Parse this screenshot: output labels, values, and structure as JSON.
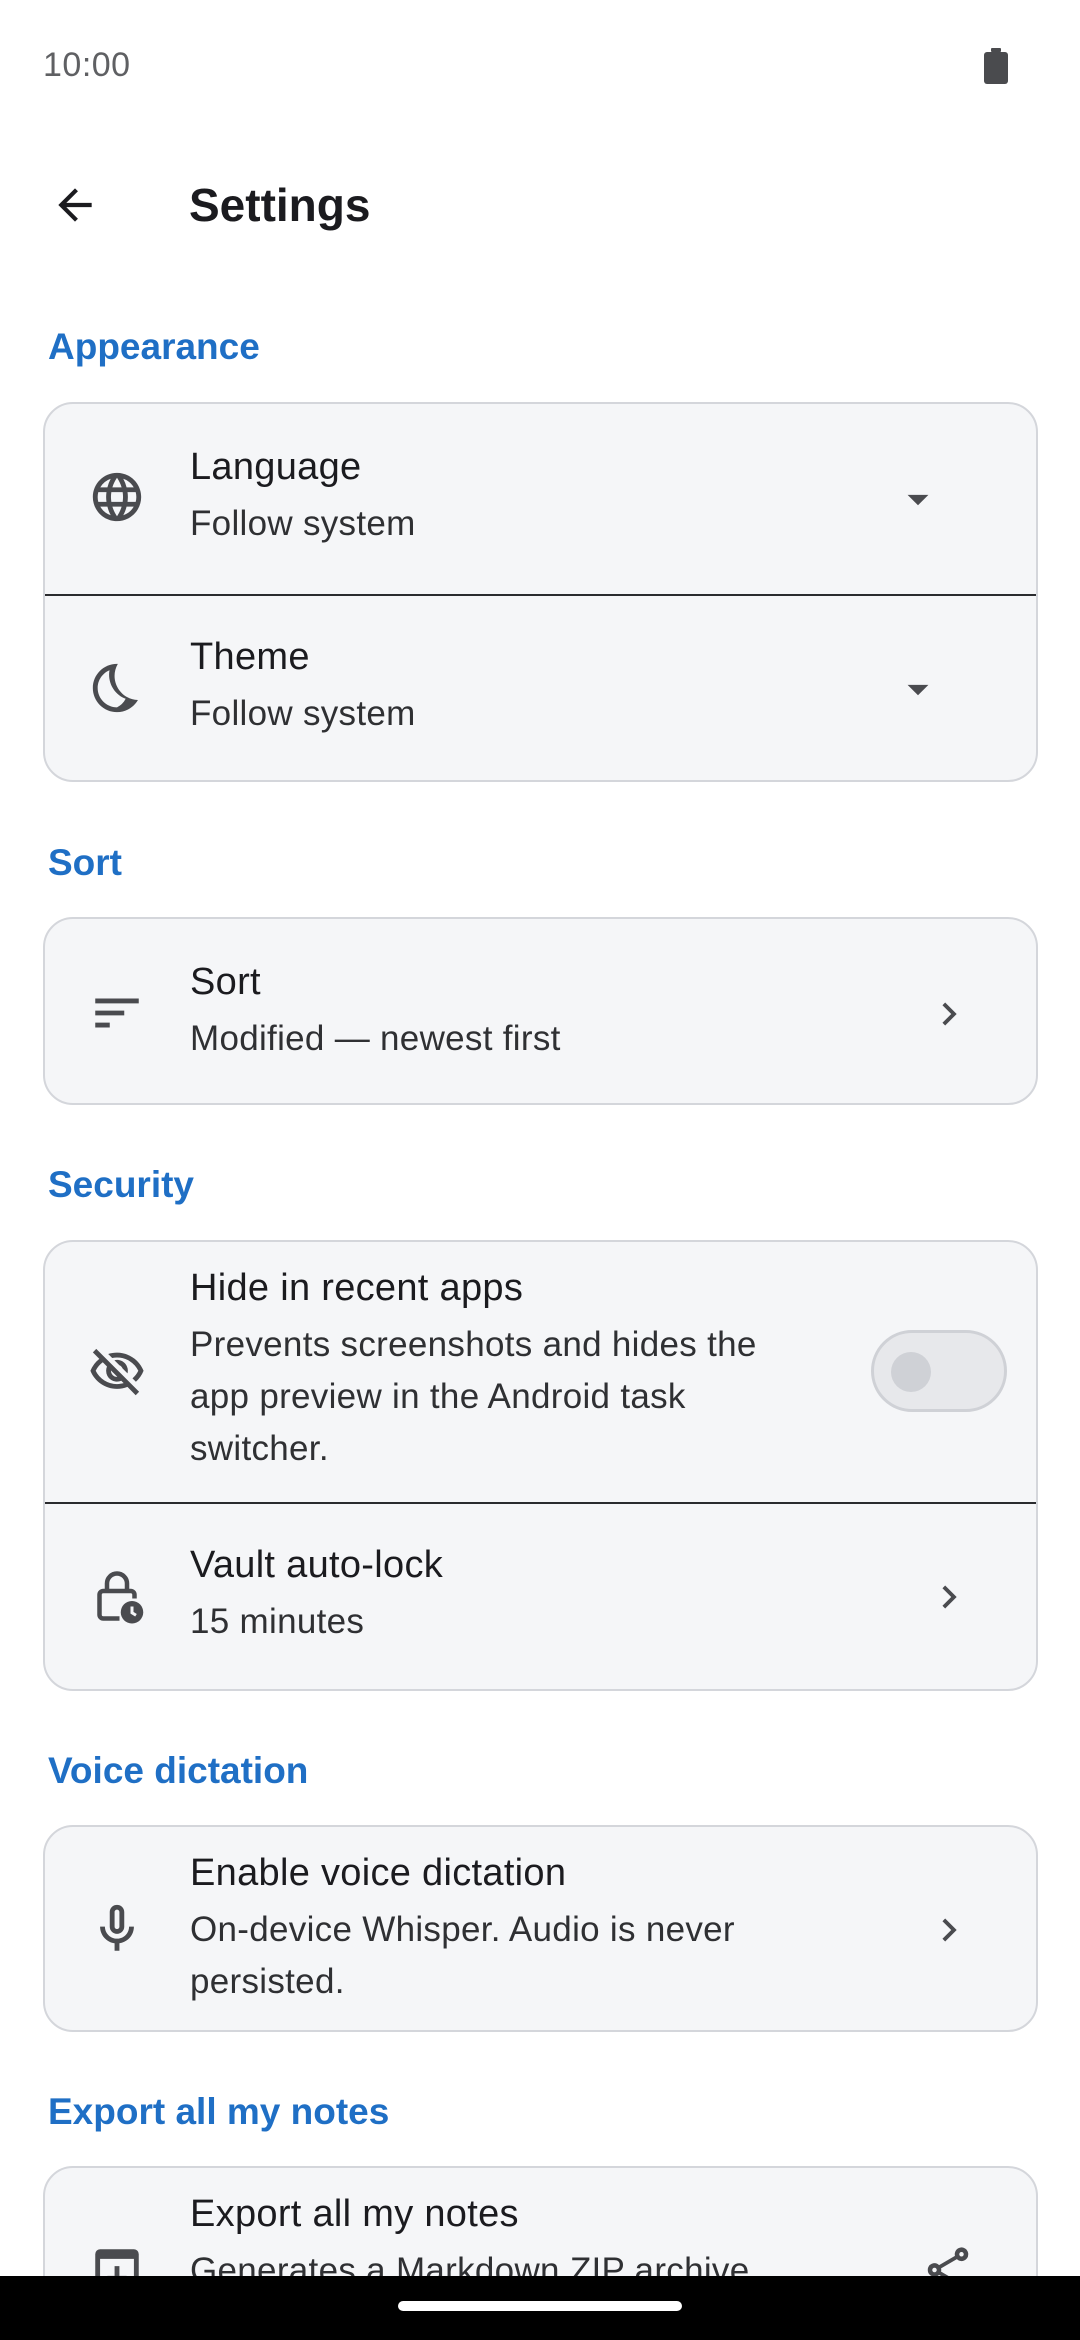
{
  "status_bar": {
    "time": "10:00"
  },
  "app_bar": {
    "title": "Settings"
  },
  "sections": {
    "appearance": {
      "title": "Appearance",
      "language": {
        "title": "Language",
        "subtitle": "Follow system"
      },
      "theme": {
        "title": "Theme",
        "subtitle": "Follow system"
      }
    },
    "sort": {
      "title": "Sort",
      "sort": {
        "title": "Sort",
        "subtitle": "Modified — newest first"
      }
    },
    "security": {
      "title": "Security",
      "hide_recent": {
        "title": "Hide in recent apps",
        "subtitle": "Prevents screenshots and hides the app preview in the Android task switcher.",
        "enabled": false
      },
      "auto_lock": {
        "title": "Vault auto-lock",
        "subtitle": "15 minutes"
      }
    },
    "voice": {
      "title": "Voice dictation",
      "enable": {
        "title": "Enable voice dictation",
        "subtitle": "On-device Whisper. Audio is never persisted."
      }
    },
    "export": {
      "title": "Export all my notes",
      "export_all": {
        "title": "Export all my notes",
        "subtitle": "Generates a Markdown ZIP archive"
      }
    }
  },
  "icons": {
    "language": "globe-icon",
    "theme": "moon-icon",
    "sort": "sort-icon",
    "hide": "eye-off-icon",
    "lock": "lock-clock-icon",
    "mic": "mic-icon",
    "export": "download-icon",
    "share": "share-icon"
  },
  "colors": {
    "accent": "#1f6fc5",
    "card_bg": "#f5f6f8",
    "card_border": "#d4d6db"
  }
}
